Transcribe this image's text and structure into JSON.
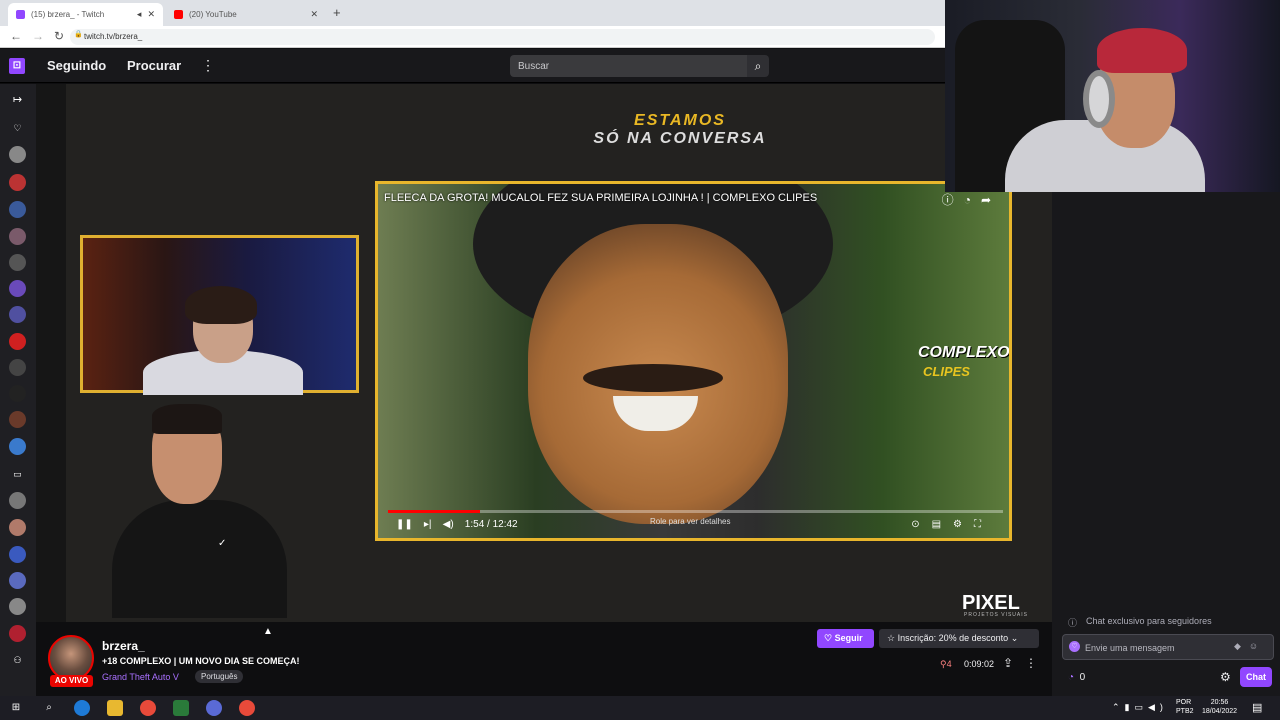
{
  "browser": {
    "tabs": [
      {
        "label": "(15) brzera_ - Twitch",
        "active": true
      },
      {
        "label": "(20) YouTube",
        "active": false
      }
    ],
    "url": "twitch.tv/brzera_"
  },
  "topnav": {
    "following": "Seguindo",
    "browse": "Procurar",
    "search_placeholder": "Buscar"
  },
  "overlay": {
    "line1": "ESTAMOS",
    "line2": "SÓ NA CONVERSA"
  },
  "video": {
    "title": "FLEECA DA GROTA! MUCALOL FEZ SUA PRIMEIRA LOJINHA ! | COMPLEXO CLIPES",
    "watermark1": "COMPLEXO",
    "watermark2": "CLIPES",
    "time": "1:54 / 12:42",
    "hint": "Role para ver detalhes",
    "progress": 0.149
  },
  "branding": {
    "pixel": "PIXEL",
    "pixel_sub": "PROJETOS VISUAIS"
  },
  "channel": {
    "name": "brzera_",
    "live_badge": "AO VIVO",
    "title": "+18 COMPLEXO | UM NOVO DIA SE COMEÇA!",
    "game": "Grand Theft Auto V",
    "tag": "Português",
    "follow": "Seguir",
    "subscribe": "Inscrição: 20% de desconto",
    "viewers": "4",
    "uptime": "0:09:02"
  },
  "chat": {
    "followers_only": "Chat exclusivo para seguidores",
    "input_placeholder": "Envie uma mensagem",
    "points": "0",
    "chat_button": "Chat"
  },
  "taskbar": {
    "lang1": "POR",
    "lang2": "PTB2",
    "time": "20:56",
    "date": "18/04/2022"
  },
  "colors": {
    "twitch_purple": "#9147ff",
    "live_red": "#eb0400",
    "overlay_gold": "#e8b62c"
  }
}
